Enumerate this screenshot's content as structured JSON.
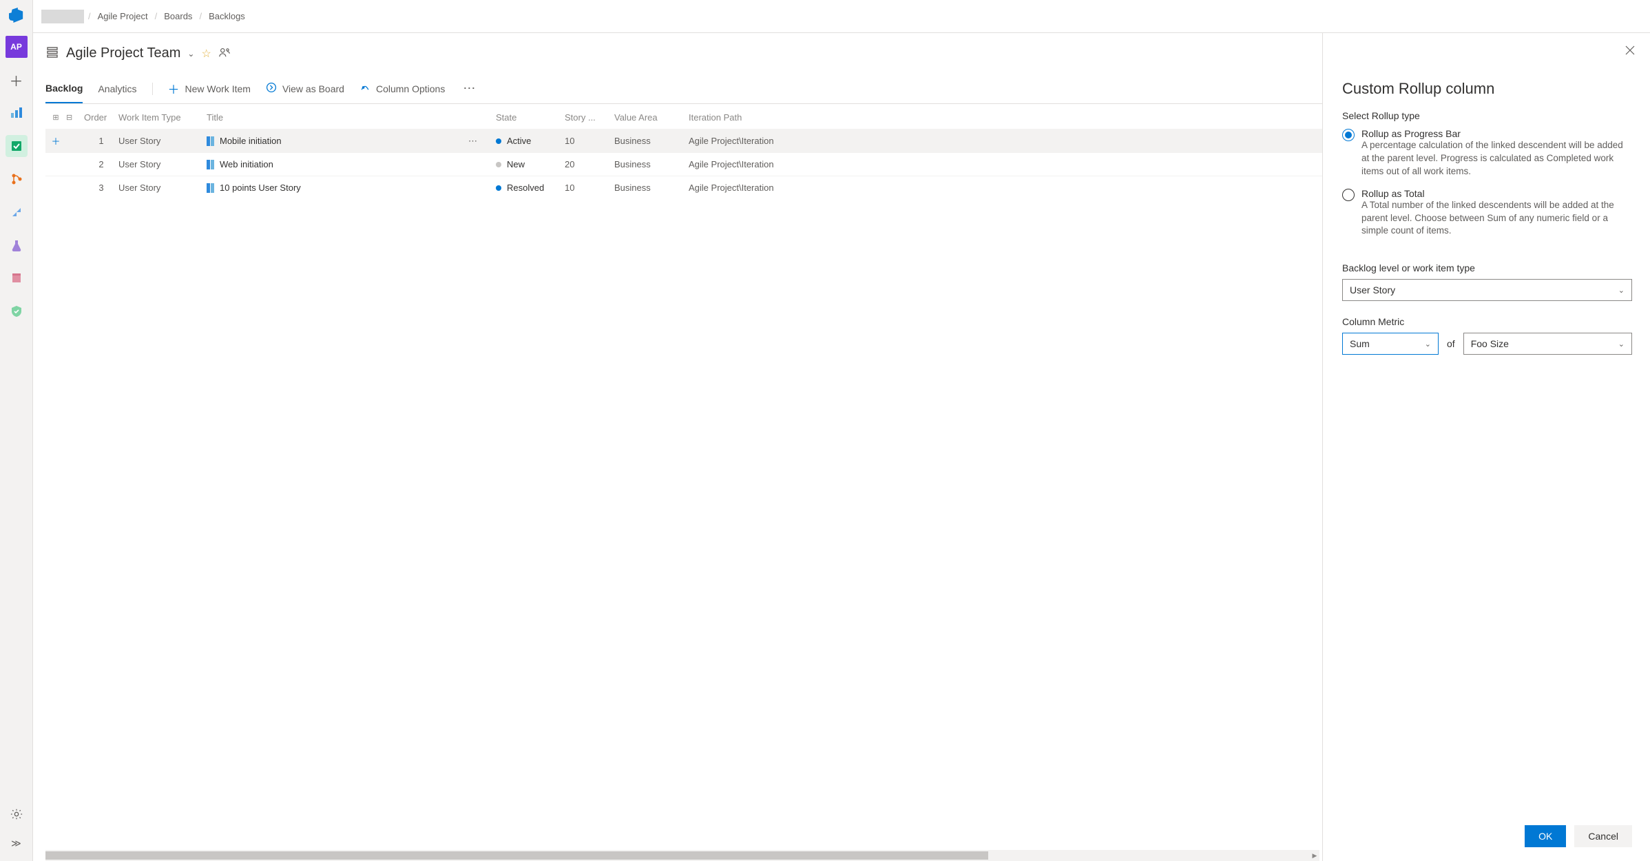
{
  "breadcrumbs": {
    "project": "Agile Project",
    "boards": "Boards",
    "backlogs": "Backlogs"
  },
  "team": {
    "name": "Agile Project Team",
    "badge": "AP"
  },
  "tabs": {
    "backlog": "Backlog",
    "analytics": "Analytics",
    "new_item": "New Work Item",
    "view_board": "View as Board",
    "col_opts": "Column Options"
  },
  "columns": {
    "order": "Order",
    "wit": "Work Item Type",
    "title": "Title",
    "state": "State",
    "story": "Story ...",
    "value": "Value Area",
    "iter": "Iteration Path"
  },
  "rows": [
    {
      "order": "1",
      "wit": "User Story",
      "title": "Mobile initiation",
      "state": "Active",
      "state_color": "#0078d4",
      "story": "10",
      "value": "Business",
      "iter": "Agile Project\\Iteration"
    },
    {
      "order": "2",
      "wit": "User Story",
      "title": "Web initiation",
      "state": "New",
      "state_color": "#c8c6c4",
      "story": "20",
      "value": "Business",
      "iter": "Agile Project\\Iteration"
    },
    {
      "order": "3",
      "wit": "User Story",
      "title": "10 points User Story",
      "state": "Resolved",
      "state_color": "#0078d4",
      "story": "10",
      "value": "Business",
      "iter": "Agile Project\\Iteration"
    }
  ],
  "panel": {
    "title": "Custom Rollup column",
    "select_type_label": "Select Rollup type",
    "opt1": {
      "title": "Rollup as Progress Bar",
      "desc": "A percentage calculation of the linked descendent will be added at the parent level. Progress is calculated as Completed work items out of all work items."
    },
    "opt2": {
      "title": "Rollup as Total",
      "desc": "A Total number of the linked descendents will be added at the parent level. Choose between Sum of any numeric field or a simple count of items."
    },
    "level_label": "Backlog level or work item type",
    "level_value": "User Story",
    "metric_label": "Column Metric",
    "metric_func": "Sum",
    "of": "of",
    "metric_field": "Foo Size",
    "ok": "OK",
    "cancel": "Cancel"
  }
}
